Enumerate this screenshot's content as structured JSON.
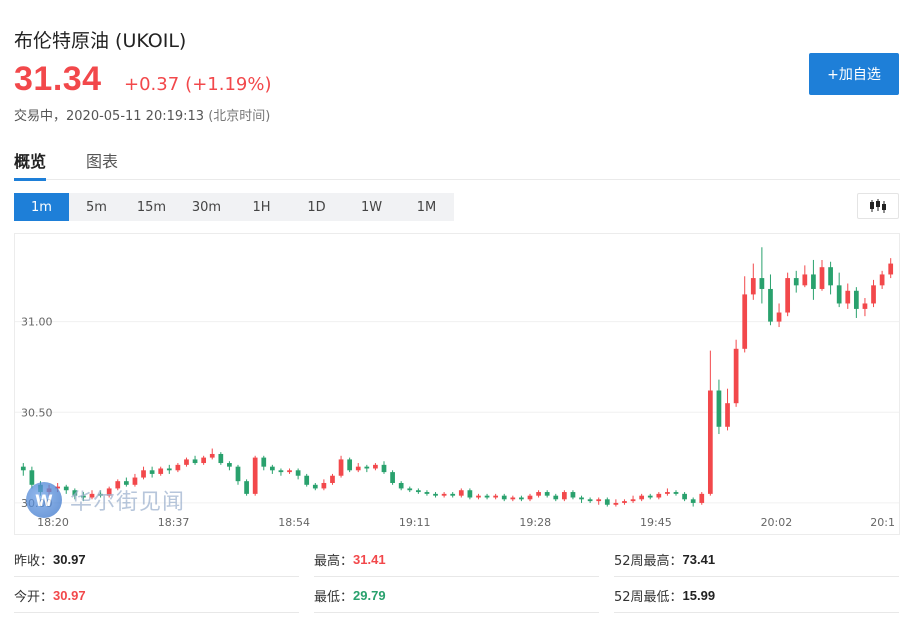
{
  "header": {
    "title": "布伦特原油 (UKOIL)",
    "price": "31.34",
    "change": "+0.37",
    "change_pct": "(+1.19%)",
    "status": "交易中，2020-05-11 20:19:13",
    "timezone": "(北京时间)",
    "add_button": "+加自选"
  },
  "tabs": [
    {
      "label": "概览",
      "active": true
    },
    {
      "label": "图表",
      "active": false
    }
  ],
  "periods": [
    "1m",
    "5m",
    "15m",
    "30m",
    "1H",
    "1D",
    "1W",
    "1M"
  ],
  "active_period": "1m",
  "chart_type_icon": "candlestick-icon",
  "watermark": {
    "logo_letter": "W",
    "text": "华尔街见闻"
  },
  "colors": {
    "up": "#f2484b",
    "down": "#29a16d",
    "accent": "#1e7fd8"
  },
  "stats": [
    {
      "label": "昨收：",
      "value": "30.97",
      "color": "black"
    },
    {
      "label": "最高：",
      "value": "31.41",
      "color": "red"
    },
    {
      "label": "52周最高：",
      "value": "73.41",
      "color": "black"
    },
    {
      "label": "今开：",
      "value": "30.97",
      "color": "red"
    },
    {
      "label": "最低：",
      "value": "29.79",
      "color": "green"
    },
    {
      "label": "52周最低：",
      "value": "15.99",
      "color": "black"
    }
  ],
  "chart_data": {
    "type": "candlestick",
    "y_ticks": [
      "31.00",
      "30.50",
      "30.00"
    ],
    "y_tick_values": [
      31.0,
      30.5,
      30.0
    ],
    "x_ticks": [
      "18:20",
      "18:37",
      "18:54",
      "19:11",
      "19:28",
      "19:45",
      "20:02",
      "20:1"
    ],
    "ylim": [
      29.95,
      31.45
    ],
    "grid": true,
    "candles": [
      {
        "o": 30.2,
        "c": 30.18,
        "h": 30.22,
        "l": 30.15
      },
      {
        "o": 30.18,
        "c": 30.1,
        "h": 30.2,
        "l": 30.08
      },
      {
        "o": 30.1,
        "c": 30.06,
        "h": 30.12,
        "l": 30.04
      },
      {
        "o": 30.06,
        "c": 30.08,
        "h": 30.1,
        "l": 30.04
      },
      {
        "o": 30.08,
        "c": 30.09,
        "h": 30.11,
        "l": 30.06
      },
      {
        "o": 30.09,
        "c": 30.07,
        "h": 30.1,
        "l": 30.05
      },
      {
        "o": 30.07,
        "c": 30.04,
        "h": 30.08,
        "l": 30.02
      },
      {
        "o": 30.04,
        "c": 30.03,
        "h": 30.06,
        "l": 30.01
      },
      {
        "o": 30.03,
        "c": 30.05,
        "h": 30.07,
        "l": 30.02
      },
      {
        "o": 30.05,
        "c": 30.04,
        "h": 30.07,
        "l": 30.03
      },
      {
        "o": 30.04,
        "c": 30.08,
        "h": 30.09,
        "l": 30.03
      },
      {
        "o": 30.08,
        "c": 30.12,
        "h": 30.13,
        "l": 30.07
      },
      {
        "o": 30.12,
        "c": 30.1,
        "h": 30.14,
        "l": 30.09
      },
      {
        "o": 30.1,
        "c": 30.14,
        "h": 30.16,
        "l": 30.09
      },
      {
        "o": 30.14,
        "c": 30.18,
        "h": 30.2,
        "l": 30.13
      },
      {
        "o": 30.18,
        "c": 30.16,
        "h": 30.2,
        "l": 30.14
      },
      {
        "o": 30.16,
        "c": 30.19,
        "h": 30.2,
        "l": 30.15
      },
      {
        "o": 30.19,
        "c": 30.18,
        "h": 30.21,
        "l": 30.16
      },
      {
        "o": 30.18,
        "c": 30.21,
        "h": 30.22,
        "l": 30.17
      },
      {
        "o": 30.21,
        "c": 30.24,
        "h": 30.25,
        "l": 30.2
      },
      {
        "o": 30.24,
        "c": 30.22,
        "h": 30.26,
        "l": 30.21
      },
      {
        "o": 30.22,
        "c": 30.25,
        "h": 30.26,
        "l": 30.21
      },
      {
        "o": 30.25,
        "c": 30.27,
        "h": 30.3,
        "l": 30.24
      },
      {
        "o": 30.27,
        "c": 30.22,
        "h": 30.28,
        "l": 30.21
      },
      {
        "o": 30.22,
        "c": 30.2,
        "h": 30.23,
        "l": 30.18
      },
      {
        "o": 30.2,
        "c": 30.12,
        "h": 30.21,
        "l": 30.1
      },
      {
        "o": 30.12,
        "c": 30.05,
        "h": 30.13,
        "l": 30.04
      },
      {
        "o": 30.05,
        "c": 30.25,
        "h": 30.26,
        "l": 30.04
      },
      {
        "o": 30.25,
        "c": 30.2,
        "h": 30.26,
        "l": 30.18
      },
      {
        "o": 30.2,
        "c": 30.18,
        "h": 30.21,
        "l": 30.16
      },
      {
        "o": 30.18,
        "c": 30.17,
        "h": 30.19,
        "l": 30.15
      },
      {
        "o": 30.17,
        "c": 30.18,
        "h": 30.19,
        "l": 30.16
      },
      {
        "o": 30.18,
        "c": 30.15,
        "h": 30.19,
        "l": 30.13
      },
      {
        "o": 30.15,
        "c": 30.1,
        "h": 30.16,
        "l": 30.09
      },
      {
        "o": 30.1,
        "c": 30.08,
        "h": 30.11,
        "l": 30.07
      },
      {
        "o": 30.08,
        "c": 30.11,
        "h": 30.13,
        "l": 30.07
      },
      {
        "o": 30.11,
        "c": 30.15,
        "h": 30.16,
        "l": 30.1
      },
      {
        "o": 30.15,
        "c": 30.24,
        "h": 30.26,
        "l": 30.14
      },
      {
        "o": 30.24,
        "c": 30.18,
        "h": 30.25,
        "l": 30.17
      },
      {
        "o": 30.18,
        "c": 30.2,
        "h": 30.22,
        "l": 30.17
      },
      {
        "o": 30.2,
        "c": 30.19,
        "h": 30.21,
        "l": 30.17
      },
      {
        "o": 30.19,
        "c": 30.21,
        "h": 30.22,
        "l": 30.18
      },
      {
        "o": 30.21,
        "c": 30.17,
        "h": 30.23,
        "l": 30.16
      },
      {
        "o": 30.17,
        "c": 30.11,
        "h": 30.18,
        "l": 30.1
      },
      {
        "o": 30.11,
        "c": 30.08,
        "h": 30.12,
        "l": 30.07
      },
      {
        "o": 30.08,
        "c": 30.07,
        "h": 30.09,
        "l": 30.06
      },
      {
        "o": 30.07,
        "c": 30.06,
        "h": 30.08,
        "l": 30.05
      },
      {
        "o": 30.06,
        "c": 30.05,
        "h": 30.07,
        "l": 30.04
      },
      {
        "o": 30.05,
        "c": 30.04,
        "h": 30.06,
        "l": 30.03
      },
      {
        "o": 30.04,
        "c": 30.05,
        "h": 30.06,
        "l": 30.03
      },
      {
        "o": 30.05,
        "c": 30.04,
        "h": 30.06,
        "l": 30.03
      },
      {
        "o": 30.04,
        "c": 30.07,
        "h": 30.08,
        "l": 30.03
      },
      {
        "o": 30.07,
        "c": 30.03,
        "h": 30.08,
        "l": 30.02
      },
      {
        "o": 30.03,
        "c": 30.04,
        "h": 30.05,
        "l": 30.02
      },
      {
        "o": 30.04,
        "c": 30.03,
        "h": 30.05,
        "l": 30.02
      },
      {
        "o": 30.03,
        "c": 30.04,
        "h": 30.05,
        "l": 30.02
      },
      {
        "o": 30.04,
        "c": 30.02,
        "h": 30.05,
        "l": 30.01
      },
      {
        "o": 30.02,
        "c": 30.03,
        "h": 30.04,
        "l": 30.01
      },
      {
        "o": 30.03,
        "c": 30.02,
        "h": 30.04,
        "l": 30.01
      },
      {
        "o": 30.02,
        "c": 30.04,
        "h": 30.05,
        "l": 30.01
      },
      {
        "o": 30.04,
        "c": 30.06,
        "h": 30.07,
        "l": 30.03
      },
      {
        "o": 30.06,
        "c": 30.04,
        "h": 30.07,
        "l": 30.03
      },
      {
        "o": 30.04,
        "c": 30.02,
        "h": 30.05,
        "l": 30.01
      },
      {
        "o": 30.02,
        "c": 30.06,
        "h": 30.07,
        "l": 30.01
      },
      {
        "o": 30.06,
        "c": 30.03,
        "h": 30.07,
        "l": 30.02
      },
      {
        "o": 30.03,
        "c": 30.02,
        "h": 30.04,
        "l": 30.0
      },
      {
        "o": 30.02,
        "c": 30.01,
        "h": 30.03,
        "l": 30.0
      },
      {
        "o": 30.01,
        "c": 30.02,
        "h": 30.03,
        "l": 29.99
      },
      {
        "o": 30.02,
        "c": 29.99,
        "h": 30.03,
        "l": 29.98
      },
      {
        "o": 29.99,
        "c": 30.0,
        "h": 30.02,
        "l": 29.98
      },
      {
        "o": 30.0,
        "c": 30.01,
        "h": 30.02,
        "l": 29.99
      },
      {
        "o": 30.01,
        "c": 30.02,
        "h": 30.04,
        "l": 30.0
      },
      {
        "o": 30.02,
        "c": 30.04,
        "h": 30.05,
        "l": 30.01
      },
      {
        "o": 30.04,
        "c": 30.03,
        "h": 30.05,
        "l": 30.02
      },
      {
        "o": 30.03,
        "c": 30.05,
        "h": 30.06,
        "l": 30.02
      },
      {
        "o": 30.05,
        "c": 30.06,
        "h": 30.08,
        "l": 30.04
      },
      {
        "o": 30.06,
        "c": 30.05,
        "h": 30.07,
        "l": 30.04
      },
      {
        "o": 30.05,
        "c": 30.02,
        "h": 30.06,
        "l": 30.01
      },
      {
        "o": 30.02,
        "c": 30.0,
        "h": 30.03,
        "l": 29.98
      },
      {
        "o": 30.0,
        "c": 30.05,
        "h": 30.06,
        "l": 29.99
      },
      {
        "o": 30.05,
        "c": 30.62,
        "h": 30.84,
        "l": 30.04
      },
      {
        "o": 30.62,
        "c": 30.42,
        "h": 30.68,
        "l": 30.38
      },
      {
        "o": 30.42,
        "c": 30.55,
        "h": 30.63,
        "l": 30.4
      },
      {
        "o": 30.55,
        "c": 30.85,
        "h": 30.9,
        "l": 30.53
      },
      {
        "o": 30.85,
        "c": 31.15,
        "h": 31.25,
        "l": 30.83
      },
      {
        "o": 31.15,
        "c": 31.24,
        "h": 31.32,
        "l": 31.12
      },
      {
        "o": 31.24,
        "c": 31.18,
        "h": 31.41,
        "l": 31.1
      },
      {
        "o": 31.18,
        "c": 31.0,
        "h": 31.26,
        "l": 30.98
      },
      {
        "o": 31.0,
        "c": 31.05,
        "h": 31.1,
        "l": 30.97
      },
      {
        "o": 31.05,
        "c": 31.24,
        "h": 31.27,
        "l": 31.03
      },
      {
        "o": 31.24,
        "c": 31.2,
        "h": 31.28,
        "l": 31.16
      },
      {
        "o": 31.2,
        "c": 31.26,
        "h": 31.31,
        "l": 31.19
      },
      {
        "o": 31.26,
        "c": 31.18,
        "h": 31.34,
        "l": 31.12
      },
      {
        "o": 31.18,
        "c": 31.3,
        "h": 31.34,
        "l": 31.17
      },
      {
        "o": 31.3,
        "c": 31.2,
        "h": 31.33,
        "l": 31.15
      },
      {
        "o": 31.2,
        "c": 31.1,
        "h": 31.27,
        "l": 31.08
      },
      {
        "o": 31.1,
        "c": 31.17,
        "h": 31.21,
        "l": 31.07
      },
      {
        "o": 31.17,
        "c": 31.07,
        "h": 31.19,
        "l": 31.02
      },
      {
        "o": 31.07,
        "c": 31.1,
        "h": 31.13,
        "l": 31.03
      },
      {
        "o": 31.1,
        "c": 31.2,
        "h": 31.23,
        "l": 31.08
      },
      {
        "o": 31.2,
        "c": 31.26,
        "h": 31.28,
        "l": 31.18
      },
      {
        "o": 31.26,
        "c": 31.32,
        "h": 31.35,
        "l": 31.24
      }
    ]
  }
}
